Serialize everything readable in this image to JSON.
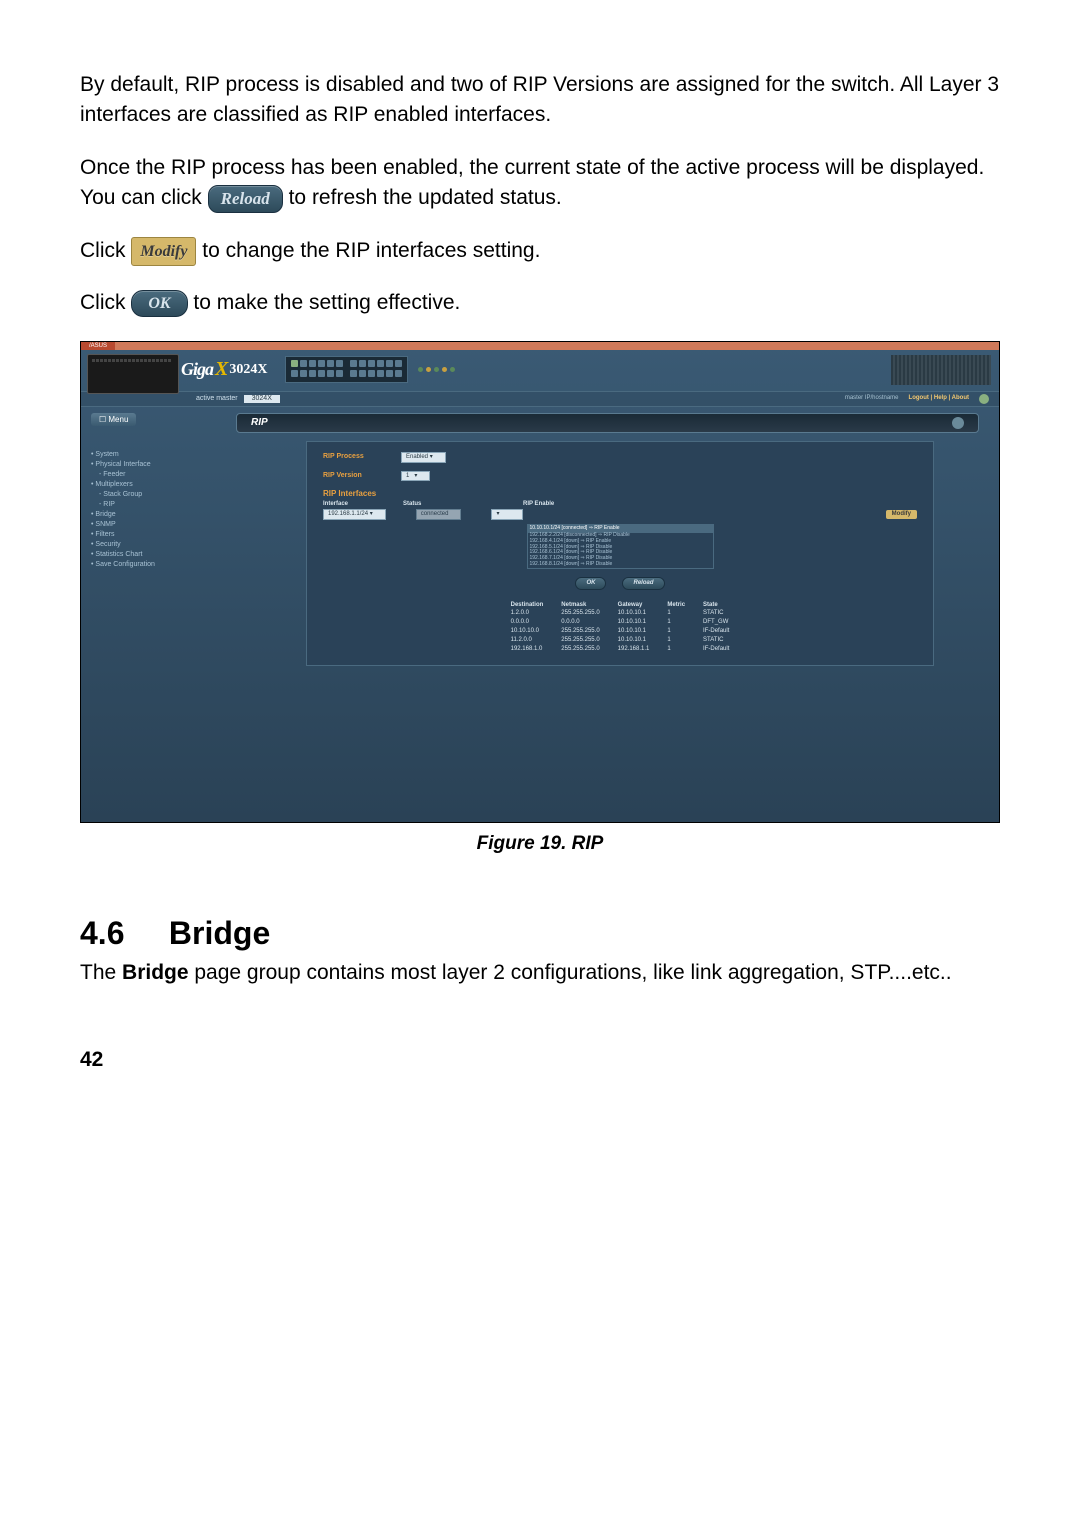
{
  "body": {
    "p1": "By default, RIP process is disabled and two of RIP Versions are assigned for the switch. All Layer 3 interfaces are classified as RIP enabled interfaces.",
    "p2a": "Once the RIP process has been enabled, the current state of the active process will be displayed. You can click ",
    "p2b": " to refresh the updated status.",
    "p3a": "Click ",
    "p3b": " to change the RIP interfaces setting.",
    "p4a": "Click ",
    "p4b": " to make the setting effective.",
    "reload_btn": "Reload",
    "modify_btn": "Modify",
    "ok_btn": "OK"
  },
  "caption": "Figure 19.   RIP",
  "section": {
    "num": "4.6",
    "title": "Bridge"
  },
  "section_body_a": "The ",
  "section_body_bold": "Bridge",
  "section_body_b": " page group contains most layer 2 configurations, like link aggregation, STP....etc..",
  "page_number": "42",
  "ss": {
    "asus": "/ASUS",
    "logo": {
      "brand": "Giga",
      "x": "X",
      "model": "3024X"
    },
    "subbar": {
      "left_label": "active master",
      "dd": "3024X",
      "right_text": "master IP/hostname",
      "links": "Logout | Help | About"
    },
    "menu_head": "☐ Menu",
    "menu": [
      "• System",
      "• Physical Interface",
      "   - Feeder",
      "• Multiplexers",
      "   - Stack Group",
      "   - RIP",
      "• Bridge",
      "• SNMP",
      "• Filters",
      "• Security",
      "• Statistics Chart",
      "• Save Configuration"
    ],
    "rip_title": "RIP",
    "form": {
      "process_label": "RIP Process",
      "process_value": "Enabled",
      "version_label": "RIP Version",
      "version_value": "1"
    },
    "iface_section": "RIP Interfaces",
    "iface_headers": [
      "Interface",
      "Status",
      "RIP Enable"
    ],
    "iface_sel": "192.168.1.1/24",
    "iface_status": "connected",
    "modify": "Modify",
    "log": [
      "10.10.10.1/24 [connected] ⇒ RIP Enable",
      "192.168.2.2/24 [disconnected] ⇒ RIP Disable",
      "192.168.4.1/24 [down] ⇒ RIP Enable",
      "192.168.5.1/24 [down] ⇒ RIP Disable",
      "192.168.6.1/24 [down] ⇒ RIP Disable",
      "192.168.7.1/24 [down] ⇒ RIP Disable",
      "192.168.8.1/24 [down] ⇒ RIP Disable"
    ],
    "ok": "OK",
    "reload": "Reload",
    "route": {
      "headers": [
        "Destination",
        "Netmask",
        "Gateway",
        "Metric",
        "State"
      ],
      "rows": [
        [
          "1.2.0.0",
          "255.255.255.0",
          "10.10.10.1",
          "1",
          "STATIC"
        ],
        [
          "0.0.0.0",
          "0.0.0.0",
          "10.10.10.1",
          "1",
          "DFT_GW"
        ],
        [
          "10.10.10.0",
          "255.255.255.0",
          "10.10.10.1",
          "1",
          "IF-Default"
        ],
        [
          "11.2.0.0",
          "255.255.255.0",
          "10.10.10.1",
          "1",
          "STATIC"
        ],
        [
          "192.168.1.0",
          "255.255.255.0",
          "192.168.1.1",
          "1",
          "IF-Default"
        ]
      ]
    }
  }
}
